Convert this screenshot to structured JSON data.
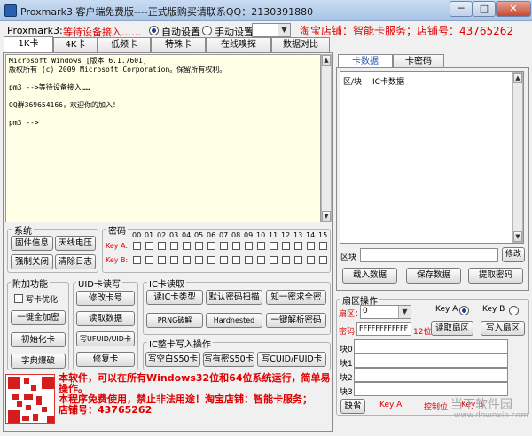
{
  "window": {
    "title": "Proxmark3 客户端",
    "ad": "免费版----正式版购买请联系QQ：2130391880",
    "minimize": "─",
    "maximize": "□",
    "close": "✕"
  },
  "status": {
    "label": "Proxmark3:",
    "value": "等待设备接入……",
    "auto_label": "自动设置",
    "manual_label": "手动设置",
    "port_value": "",
    "shop": "淘宝店铺：智能卡服务；店铺号：43765262"
  },
  "tabs": [
    {
      "label": "1K卡",
      "active": true
    },
    {
      "label": "4K卡",
      "active": false
    },
    {
      "label": "低频卡",
      "active": false
    },
    {
      "label": "特殊卡",
      "active": false
    },
    {
      "label": "在线嗅探",
      "active": false
    },
    {
      "label": "数据对比",
      "active": false
    }
  ],
  "console": {
    "text": "Microsoft Windows [版本 6.1.7601]\n版权所有 (c) 2009 Microsoft Corporation。保留所有权利。\n\npm3 -->等待设备接入……\n\nQQ群369654166，欢迎你的加入！\n\npm3 -->"
  },
  "system": {
    "title": "系统",
    "buttons": [
      "固件信息",
      "天线电压",
      "强制关闭",
      "清除日志"
    ]
  },
  "password": {
    "title": "密码",
    "headers": [
      "00",
      "01",
      "02",
      "03",
      "04",
      "05",
      "06",
      "07",
      "08",
      "09",
      "10",
      "11",
      "12",
      "13",
      "14",
      "15"
    ],
    "key_a": "Key A:",
    "key_b": "Key B:"
  },
  "extra": {
    "title": "附加功能",
    "checkbox_label": "写卡优化",
    "buttons": [
      "一键全加密",
      "初始化卡",
      "字典爆破"
    ]
  },
  "uid": {
    "title": "UID卡读写",
    "buttons": [
      "修改卡号",
      "读取数据",
      "写UFUID/UID卡",
      "修复卡"
    ]
  },
  "ic_read": {
    "title": "IC卡读取",
    "buttons": [
      "读IC卡类型",
      "默认密码扫描",
      "知一密求全密",
      "PRNG破解",
      "Hardnested",
      "一键解析密码"
    ]
  },
  "ic_write": {
    "title": "IC整卡写入操作",
    "buttons": [
      "写空白S50卡",
      "写有密S50卡",
      "写CUID/FUID卡"
    ]
  },
  "right": {
    "tabs": [
      {
        "label": "卡数据",
        "active": true
      },
      {
        "label": "卡密码",
        "active": false
      }
    ],
    "col_block": "区/块",
    "col_data": "IC卡数据",
    "block_label": "区块",
    "block_value": "",
    "edit_button": "修改",
    "buttons": [
      "载入数据",
      "保存数据",
      "提取密码"
    ]
  },
  "sector": {
    "title": "扇区操作",
    "sector_label": "扇区：",
    "sector_value": "0",
    "key_a": "Key A",
    "key_b": "Key B",
    "password_label": "密码",
    "password_value": "FFFFFFFFFFFF",
    "bits": "12位",
    "read_button": "读取扇区",
    "write_button": "写入扇区",
    "blocks": [
      "块0",
      "块1",
      "块2",
      "块3"
    ],
    "default_button": "缺省",
    "control_label": "控制位"
  },
  "footer": {
    "line1": "本软件，可以在所有Windows32位和64位系统运行，简单易",
    "line2": "操作。",
    "line3": "本程序免费使用，禁止非法用途！淘宝店铺：智能卡服务；",
    "line4": "店铺号：43765262"
  },
  "watermark": {
    "brand": "当下软件园",
    "url": "www.downxia.com"
  },
  "colors": {
    "accent": "#e00000",
    "title_bar": "#b9d1ee"
  }
}
